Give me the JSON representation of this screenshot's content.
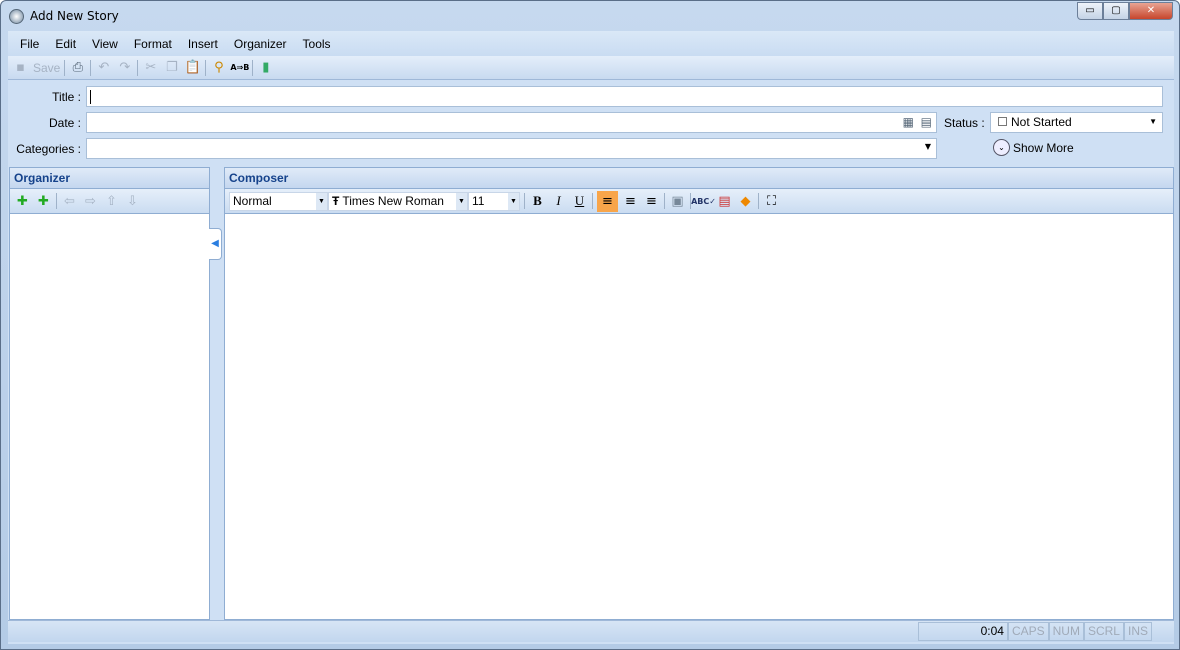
{
  "window": {
    "title": "Add New Story",
    "controls": {
      "minimize": "▭",
      "maximize": "▢",
      "close": "✕"
    }
  },
  "menu": [
    "File",
    "Edit",
    "View",
    "Format",
    "Insert",
    "Organizer",
    "Tools"
  ],
  "toolbar": {
    "save_label": "Save"
  },
  "form": {
    "title_label": "Title :",
    "title_value": "",
    "date_label": "Date :",
    "date_value": "",
    "categories_label": "Categories :",
    "categories_value": "",
    "status_label": "Status :",
    "status_value": "Not Started",
    "show_more_label": "Show More"
  },
  "organizer": {
    "header": "Organizer"
  },
  "composer": {
    "header": "Composer",
    "style_value": "Normal",
    "font_value": "Times New Roman",
    "size_value": "11"
  },
  "statusbar": {
    "time": "0:04",
    "caps": "CAPS",
    "num": "NUM",
    "scrl": "SCRL",
    "ins": "INS"
  },
  "colors": {
    "accent": "#15428b",
    "active_align": "#f8a54a"
  }
}
